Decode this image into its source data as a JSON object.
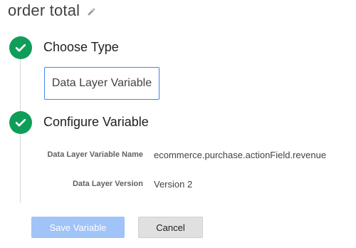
{
  "header": {
    "title": "order total",
    "edit_icon": "pencil-icon"
  },
  "steps": [
    {
      "label": "Choose Type",
      "icon": "checkmark-icon",
      "status_color": "#0f9d58"
    },
    {
      "label": "Configure Variable",
      "icon": "checkmark-icon",
      "status_color": "#0f9d58"
    }
  ],
  "choose_type": {
    "selected_type": "Data Layer Variable"
  },
  "configure": {
    "fields": [
      {
        "label": "Data Layer Variable Name",
        "value": "ecommerce.purchase.actionField.revenue"
      },
      {
        "label": "Data Layer Version",
        "value": "Version 2"
      }
    ]
  },
  "actions": {
    "save_label": "Save Variable",
    "cancel_label": "Cancel"
  },
  "colors": {
    "accent": "#4285f4",
    "success": "#0f9d58",
    "save_disabled": "#a0c3f8"
  }
}
